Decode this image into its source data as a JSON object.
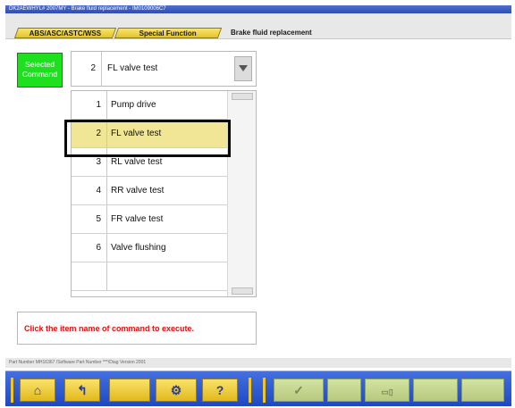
{
  "window": {
    "title": "DK2AEWHYL# 2007MY  -  Brake fluid replacement  -  IM0109006C7"
  },
  "tabs": [
    {
      "label": "ABS/ASC/ASTC/WSS"
    },
    {
      "label": "Special Function"
    },
    {
      "label": "Brake fluid replacement"
    }
  ],
  "selected_command": {
    "label_line1": "Selected",
    "label_line2": "Command",
    "number": "2",
    "value": "FL valve test"
  },
  "commands": [
    {
      "number": "1",
      "label": "Pump drive"
    },
    {
      "number": "2",
      "label": "FL valve test"
    },
    {
      "number": "3",
      "label": "RL valve test"
    },
    {
      "number": "4",
      "label": "RR valve test"
    },
    {
      "number": "5",
      "label": "FR valve test"
    },
    {
      "number": "6",
      "label": "Valve flushing"
    },
    {
      "number": "",
      "label": ""
    }
  ],
  "message": "Click the item name of command to execute.",
  "footer": {
    "part_number_text": "Part Number MH16367  /Software Part Number ***/Diag  Version 2001"
  },
  "toolbar": {
    "icons": [
      "home-icon",
      "up-icon",
      "tool-icon",
      "help-icon",
      "check-icon",
      "compare-icon"
    ],
    "home_glyph": "⌂",
    "up_glyph": "↰",
    "tool_glyph": "⚙",
    "help_glyph": "?",
    "check_glyph": "✓",
    "compare_glyph": "▭▯"
  },
  "colors": {
    "accent_blue": "#1f48c0",
    "selected_row": "#f0e696",
    "selected_command_bg": "#1fe01f",
    "message_text": "#e01010"
  }
}
